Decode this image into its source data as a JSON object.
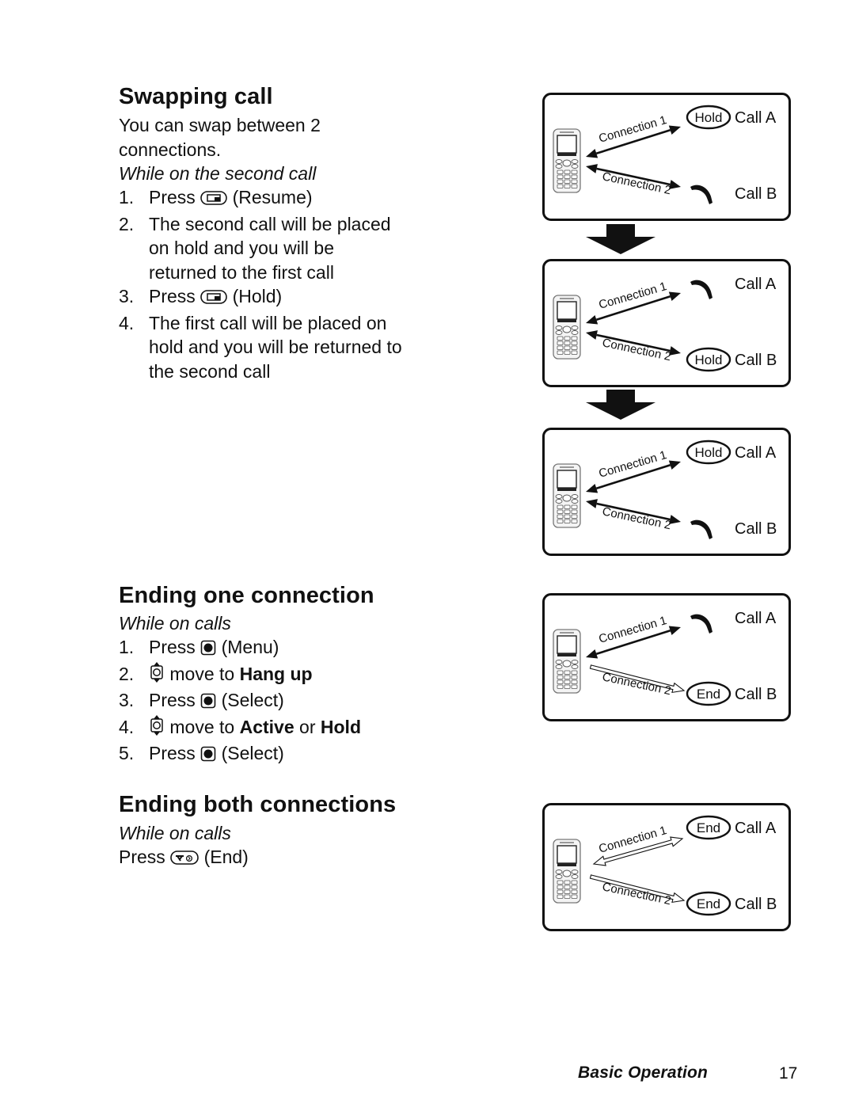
{
  "sections": {
    "swapping": {
      "title": "Swapping call",
      "intro_line1": "You can swap between 2",
      "intro_line2": "connections.",
      "context": "While on the second call",
      "steps": [
        {
          "num": "1.",
          "pre": "Press",
          "key": "soft-key-icon",
          "post": "(Resume)"
        },
        {
          "num": "2.",
          "lines": [
            "The second call will be placed",
            "on hold and you will be",
            "returned to the first call"
          ]
        },
        {
          "num": "3.",
          "pre": "Press",
          "key": "soft-key-icon",
          "post": "(Hold)"
        },
        {
          "num": "4.",
          "lines": [
            "The first call will be placed on",
            "hold and you will be returned to",
            "the second call"
          ]
        }
      ]
    },
    "ending_one": {
      "title": "Ending one connection",
      "context": "While on calls",
      "steps": [
        {
          "num": "1.",
          "pre": "Press",
          "post": "(Menu)"
        },
        {
          "num": "2.",
          "pre": "move to",
          "bold1": "Hang up"
        },
        {
          "num": "3.",
          "pre": "Press",
          "post": "(Select)"
        },
        {
          "num": "4.",
          "pre": "move to",
          "bold1": "Active",
          "mid": "or",
          "bold2": "Hold"
        },
        {
          "num": "5.",
          "pre": "Press",
          "post": "(Select)"
        }
      ]
    },
    "ending_both": {
      "title": "Ending both connections",
      "context": "While on calls",
      "press": "Press",
      "post": "(End)"
    }
  },
  "diagrams": [
    {
      "conn1_label": "Connection 1",
      "conn2_label": "Connection 2",
      "call_a": "Call A",
      "call_b": "Call B",
      "a_state": "Hold",
      "b_state": "active",
      "conn1_style": "solid",
      "conn2_style": "solid"
    },
    {
      "conn1_label": "Connection 1",
      "conn2_label": "Connection 2",
      "call_a": "Call A",
      "call_b": "Call B",
      "a_state": "active",
      "b_state": "Hold",
      "conn1_style": "solid",
      "conn2_style": "solid"
    },
    {
      "conn1_label": "Connection 1",
      "conn2_label": "Connection 2",
      "call_a": "Call A",
      "call_b": "Call B",
      "a_state": "Hold",
      "b_state": "active",
      "conn1_style": "solid",
      "conn2_style": "solid"
    },
    {
      "conn1_label": "Connection 1",
      "conn2_label": "Connection 2",
      "call_a": "Call A",
      "call_b": "Call B",
      "a_state": "active",
      "b_state": "End",
      "conn1_style": "solid",
      "conn2_style": "hollow"
    },
    {
      "conn1_label": "Connection 1",
      "conn2_label": "Connection 2",
      "call_a": "Call A",
      "call_b": "Call B",
      "a_state": "End",
      "b_state": "End",
      "conn1_style": "hollow",
      "conn2_style": "hollow"
    }
  ],
  "footer": {
    "section": "Basic Operation",
    "page": "17"
  }
}
